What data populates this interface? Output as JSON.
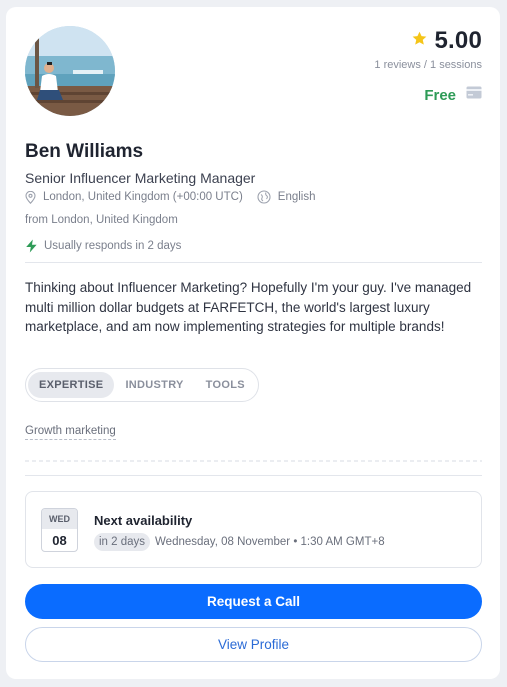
{
  "profile": {
    "name": "Ben Williams",
    "title": "Senior Influencer Marketing Manager",
    "location": "London, United Kingdom (+00:00 UTC)",
    "language": "English",
    "from": "from London, United Kingdom",
    "responds": "Usually responds in 2 days",
    "bio": "Thinking about Influencer Marketing? Hopefully I'm your guy. I've managed multi million dollar budgets at FARFETCH, the world's largest luxury marketplace, and am now implementing strategies for multiple brands!"
  },
  "rating": {
    "value": "5.00",
    "summary": "1 reviews / 1 sessions",
    "icon": "star-icon"
  },
  "price": {
    "label": "Free",
    "icon": "card-icon"
  },
  "tabs": [
    {
      "label": "EXPERTISE",
      "active": true
    },
    {
      "label": "INDUSTRY",
      "active": false
    },
    {
      "label": "TOOLS",
      "active": false
    }
  ],
  "tags": [
    "Growth marketing"
  ],
  "availability": {
    "day_of_week": "WED",
    "day": "08",
    "title": "Next availability",
    "relative": "in 2 days",
    "datetime": "Wednesday, 08 November • 1:30 AM GMT+8"
  },
  "actions": {
    "request_call": "Request a Call",
    "view_profile": "View Profile"
  },
  "colors": {
    "primary": "#0a6cff",
    "price_green": "#2e9b57",
    "star": "#f5c518",
    "bolt": "#2e9b57"
  }
}
